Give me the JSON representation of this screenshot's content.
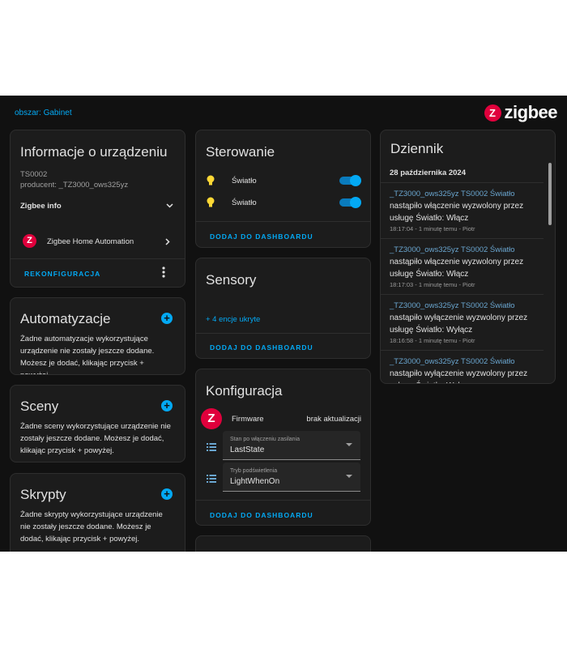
{
  "header": {
    "area_link": "obszar: Gabinet",
    "brand_logo_letter": "Z",
    "brand_text": "zigbee"
  },
  "device_info": {
    "title": "Informacje o urządzeniu",
    "model": "TS0002",
    "manufacturer": "producent: _TZ3000_ows325yz",
    "zigbee_info_label": "Zigbee info",
    "integration_label": "Zigbee Home Automation",
    "reconfigure_label": "REKONFIGURACJA"
  },
  "automations": {
    "title": "Automatyzacje",
    "empty_text": "Żadne automatyzacje wykorzystujące urządzenie nie zostały jeszcze dodane. Możesz je dodać, klikając przycisk + powyżej."
  },
  "scenes": {
    "title": "Sceny",
    "empty_text": "Żadne sceny wykorzystujące urządzenie nie zostały jeszcze dodane. Możesz je dodać, klikając przycisk + powyżej."
  },
  "scripts": {
    "title": "Skrypty",
    "empty_text": "Żadne skrypty wykorzystujące urządzenie nie zostały jeszcze dodane. Możesz je dodać, klikając przycisk + powyżej."
  },
  "controls": {
    "title": "Sterowanie",
    "items": [
      {
        "label": "Światło",
        "state": "on",
        "icon": "lightbulb-icon"
      },
      {
        "label": "Światło",
        "state": "on",
        "icon": "lightbulb-icon"
      }
    ],
    "add_to_dashboard": "DODAJ DO DASHBOARDU"
  },
  "sensors": {
    "title": "Sensory",
    "hidden_entities": "+ 4 encje ukryte",
    "add_to_dashboard": "DODAJ DO DASHBOARDU"
  },
  "configuration": {
    "title": "Konfiguracja",
    "firmware_label": "Firmware",
    "firmware_value": "brak aktualizacji",
    "power_on_state": {
      "label": "Stan po włączeniu zasilania",
      "value": "LastState"
    },
    "backlight_mode": {
      "label": "Tryb podświetlenia",
      "value": "LightWhenOn"
    },
    "add_to_dashboard": "DODAJ DO DASHBOARDU"
  },
  "logbook": {
    "title": "Dziennik",
    "date": "28 października 2024",
    "entries": [
      {
        "source": "_TZ3000_ows325yz TS0002 Światło",
        "message": "nastąpiło włączenie wyzwolony przez usługę Światło: Włącz",
        "meta": "18:17:04 - 1 minutę temu - Piotr"
      },
      {
        "source": "_TZ3000_ows325yz TS0002 Światło",
        "message": "nastąpiło włączenie wyzwolony przez usługę Światło: Włącz",
        "meta": "18:17:03 - 1 minutę temu - Piotr"
      },
      {
        "source": "_TZ3000_ows325yz TS0002 Światło",
        "message": "nastąpiło wyłączenie wyzwolony przez usługę Światło: Wyłącz",
        "meta": "18:16:58 - 1 minutę temu - Piotr"
      },
      {
        "source": "_TZ3000_ows325yz TS0002 Światło",
        "message": "nastąpiło wyłączenie wyzwolony przez usługę Światło: Wyłącz",
        "meta": ""
      }
    ]
  },
  "colors": {
    "accent": "#03a9f4",
    "zigbee_red": "#e0003c",
    "card_bg": "#1c1c1c",
    "page_bg": "#111111"
  }
}
